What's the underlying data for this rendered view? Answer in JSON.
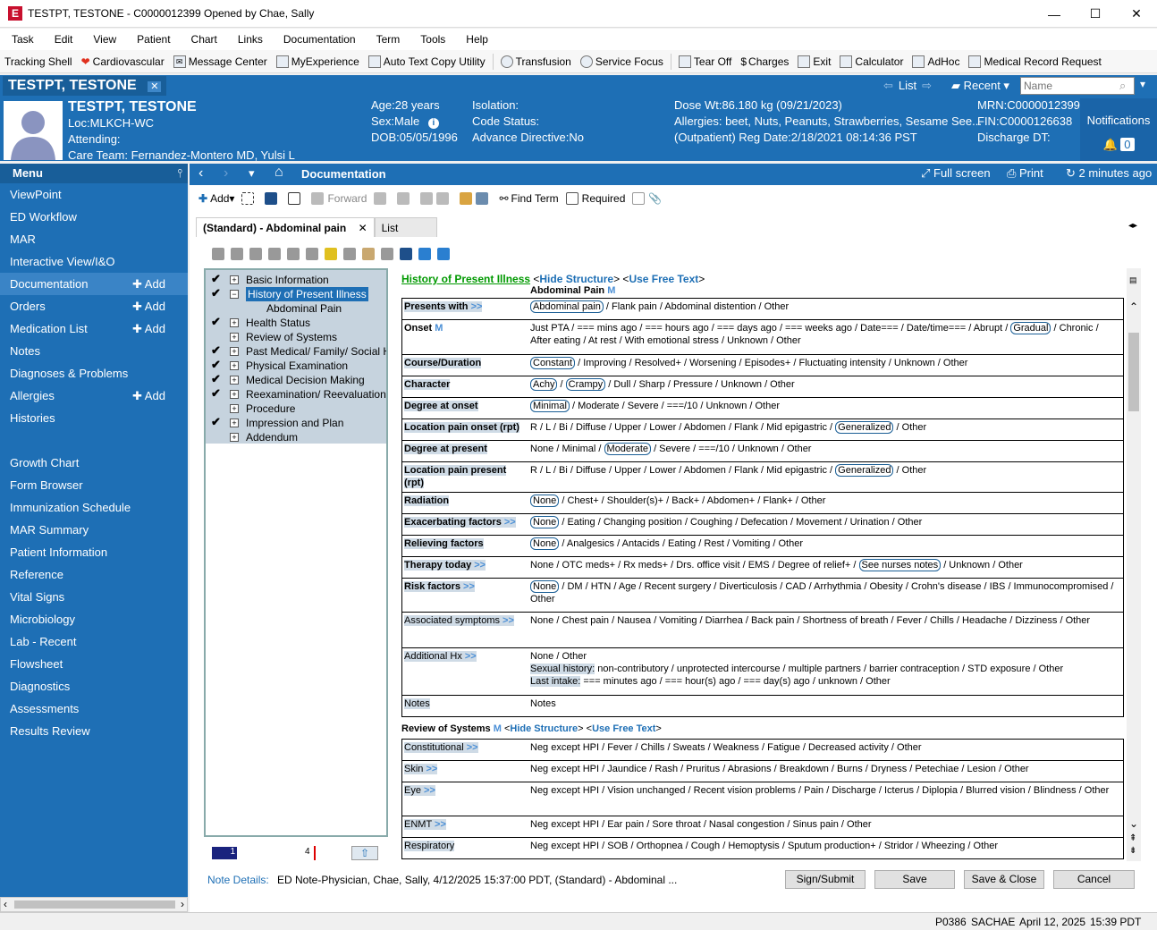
{
  "window": {
    "title": "TESTPT, TESTONE - C0000012399 Opened by Chae, Sally",
    "icon": "E"
  },
  "menu": [
    "Task",
    "Edit",
    "View",
    "Patient",
    "Chart",
    "Links",
    "Documentation",
    "Term",
    "Tools",
    "Help"
  ],
  "toolbar": [
    "Tracking Shell",
    "Cardiovascular",
    "Message Center",
    "MyExperience",
    "Auto Text Copy Utility",
    "Transfusion",
    "Service Focus",
    "Tear Off",
    "Charges",
    "Exit",
    "Calculator",
    "AdHoc",
    "Medical Record Request"
  ],
  "patient_tab": "TESTPT, TESTONE",
  "patient_nav": {
    "list": "List",
    "recent": "Recent",
    "name_placeholder": "Name"
  },
  "banner": {
    "name": "TESTPT, TESTONE",
    "loc": "Loc:MLKCH-WC",
    "attending": "Attending:",
    "care_team": "Care Team: Fernandez-Montero MD, Yulsi L",
    "age": "Age:28 years",
    "sex": "Sex:Male",
    "dob": "DOB:05/05/1996",
    "isolation": "Isolation:",
    "code_status": "Code Status:",
    "advance": "Advance Directive:No",
    "dose_wt": "Dose Wt:86.180 kg (09/21/2023)",
    "allergies": "Allergies: beet, Nuts, Peanuts, Strawberries, Sesame See...",
    "reg_date": "(Outpatient) Reg Date:2/18/2021 08:14:36 PST",
    "mrn": "MRN:C0000012399",
    "fin": "FIN:C0000126638",
    "discharge": "Discharge DT:",
    "notifications": "Notifications",
    "notif_count": "0"
  },
  "sidebar": {
    "title": "Menu",
    "items": [
      {
        "label": "ViewPoint",
        "add": ""
      },
      {
        "label": "ED Workflow",
        "add": ""
      },
      {
        "label": "MAR",
        "add": ""
      },
      {
        "label": "Interactive View/I&O",
        "add": ""
      },
      {
        "label": "Documentation",
        "add": "Add"
      },
      {
        "label": "Orders",
        "add": "Add"
      },
      {
        "label": "Medication List",
        "add": "Add"
      },
      {
        "label": "Notes",
        "add": ""
      },
      {
        "label": "Diagnoses & Problems",
        "add": ""
      },
      {
        "label": "Allergies",
        "add": "Add"
      },
      {
        "label": "Histories",
        "add": ""
      },
      {
        "label": "",
        "add": ""
      },
      {
        "label": "Growth Chart",
        "add": ""
      },
      {
        "label": "Form Browser",
        "add": ""
      },
      {
        "label": "Immunization Schedule",
        "add": ""
      },
      {
        "label": "MAR Summary",
        "add": ""
      },
      {
        "label": "Patient Information",
        "add": ""
      },
      {
        "label": "Reference",
        "add": ""
      },
      {
        "label": "Vital Signs",
        "add": ""
      },
      {
        "label": "Microbiology",
        "add": ""
      },
      {
        "label": "Lab - Recent",
        "add": ""
      },
      {
        "label": "Flowsheet",
        "add": ""
      },
      {
        "label": "Diagnostics",
        "add": ""
      },
      {
        "label": "Assessments",
        "add": ""
      },
      {
        "label": "Results Review",
        "add": ""
      }
    ]
  },
  "content_header": {
    "title": "Documentation",
    "full_screen": "Full screen",
    "print": "Print",
    "updated": "2 minutes ago"
  },
  "doc_toolbar": {
    "add": "Add",
    "forward": "Forward",
    "find_term": "Find Term",
    "required": "Required"
  },
  "tabs": [
    "(Standard) - Abdominal pain",
    "List"
  ],
  "tree": [
    {
      "label": "Basic Information",
      "check": "✔",
      "box": "+",
      "indent": 0
    },
    {
      "label": "History of Present Illness",
      "check": "✔",
      "box": "−",
      "indent": 0
    },
    {
      "label": "Abdominal Pain",
      "check": "",
      "box": "",
      "indent": 1
    },
    {
      "label": "Health Status",
      "check": "✔",
      "box": "+",
      "indent": 0
    },
    {
      "label": "Review of Systems",
      "check": "",
      "box": "+",
      "indent": 0
    },
    {
      "label": "Past Medical/ Family/ Social Histo",
      "check": "✔",
      "box": "+",
      "indent": 0
    },
    {
      "label": "Physical Examination",
      "check": "✔",
      "box": "+",
      "indent": 0
    },
    {
      "label": "Medical Decision Making",
      "check": "✔",
      "box": "+",
      "indent": 0
    },
    {
      "label": "Reexamination/ Reevaluation",
      "check": "✔",
      "box": "+",
      "indent": 0
    },
    {
      "label": "Procedure",
      "check": "",
      "box": "+",
      "indent": 0
    },
    {
      "label": "Impression and Plan",
      "check": "✔",
      "box": "+",
      "indent": 0
    },
    {
      "label": "Addendum",
      "check": "",
      "box": "+",
      "indent": 0
    }
  ],
  "pager": {
    "current": "1",
    "total": "4"
  },
  "hpi": {
    "title": "History of Present Illness",
    "hide": "Hide Structure",
    "free": "Use Free Text",
    "sub": "Abdominal Pain"
  },
  "ros": {
    "title": "Review of Systems",
    "hide": "Hide Structure",
    "free": "Use Free Text"
  },
  "note_details": {
    "label": "Note Details:",
    "value": "ED Note-Physician, Chae, Sally, 4/12/2025 15:37:00 PDT, (Standard) - Abdominal ..."
  },
  "buttons": {
    "sign": "Sign/Submit",
    "save": "Save",
    "save_close": "Save & Close",
    "cancel": "Cancel"
  },
  "status": {
    "code": "P0386",
    "user": "SACHAE",
    "date": "April 12, 2025",
    "time": "15:39 PDT"
  }
}
